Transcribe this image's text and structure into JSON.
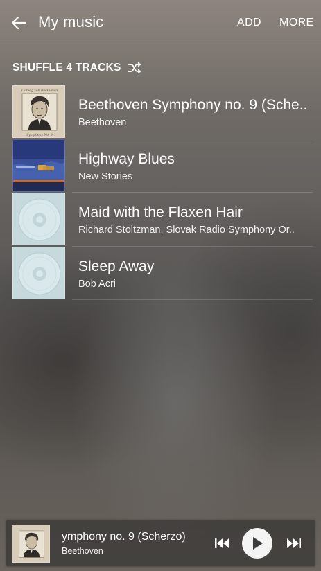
{
  "header": {
    "title": "My music",
    "add_label": "ADD",
    "more_label": "MORE"
  },
  "shuffle": {
    "label": "SHUFFLE 4 TRACKS",
    "icon": "shuffle-icon"
  },
  "tracks": [
    {
      "title": "Beethoven Symphony no. 9 (Sche..",
      "artist": "Beethoven",
      "art": "beethoven-portrait"
    },
    {
      "title": "Highway Blues",
      "artist": "New Stories",
      "art": "blue-highway-cover"
    },
    {
      "title": "Maid with the Flaxen Hair",
      "artist": "Richard Stoltzman, Slovak Radio Symphony Or..",
      "art": "cd-placeholder"
    },
    {
      "title": "Sleep Away",
      "artist": "Bob Acri",
      "art": "cd-placeholder"
    }
  ],
  "now_playing": {
    "title": "ymphony no. 9 (Scherzo)",
    "artist": "Beethoven",
    "icons": [
      "skip-previous-icon",
      "play-icon",
      "skip-next-icon"
    ]
  }
}
